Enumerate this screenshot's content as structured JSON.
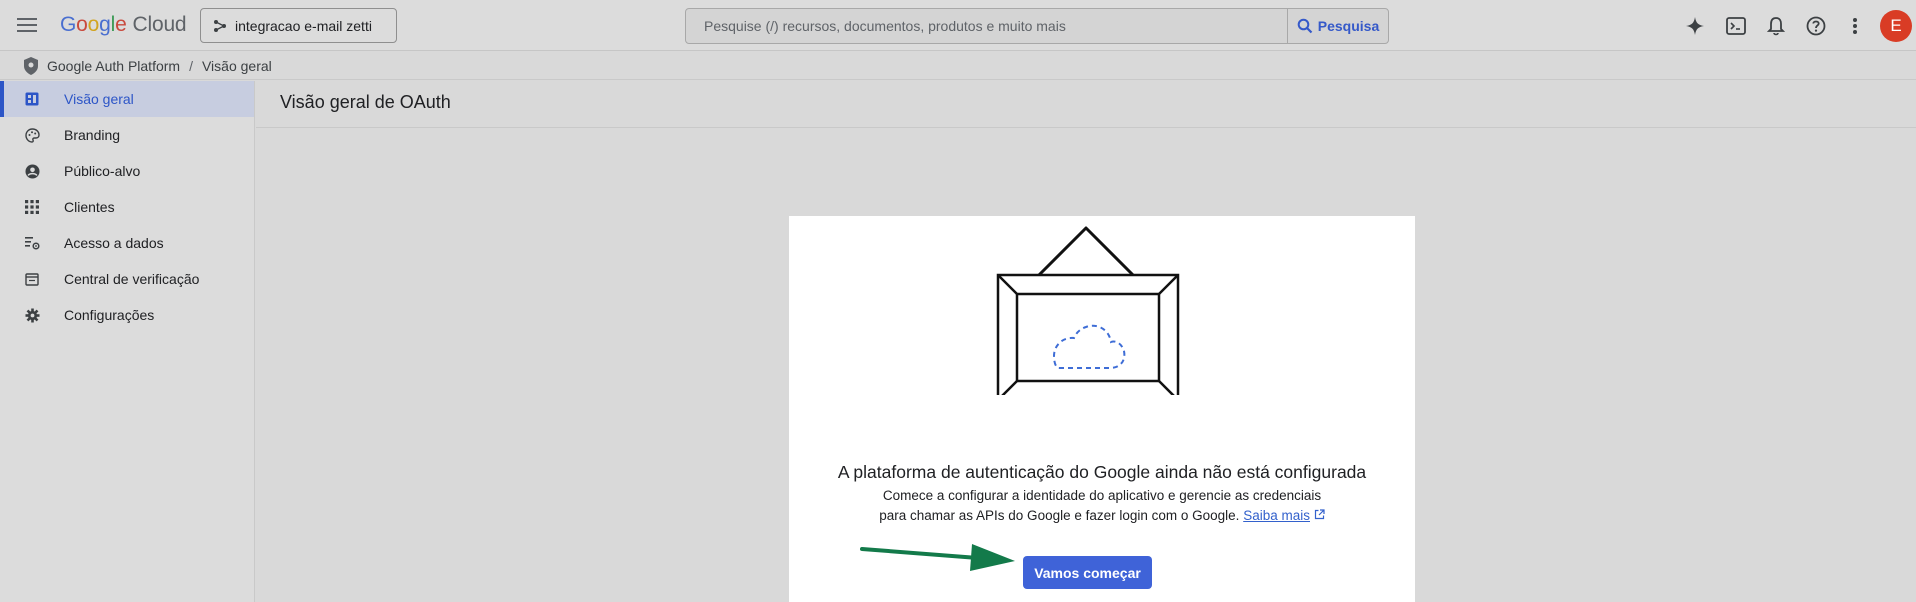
{
  "topbar": {
    "menu_icon": "hamburger-menu-icon",
    "logo_parts": [
      "G",
      "o",
      "o",
      "g",
      "l",
      "e"
    ],
    "logo_product": "Cloud",
    "project_name": "integracao e-mail zetti",
    "search_placeholder": "Pesquise (/) recursos, documentos, produtos e muito mais",
    "search_button_label": "Pesquisa",
    "icons": [
      "gemini-spark-icon",
      "cloud-shell-icon",
      "notifications-bell-icon",
      "help-icon",
      "more-vert-icon"
    ],
    "avatar_initial": "E",
    "avatar_color": "#d93c25"
  },
  "breadcrumb": {
    "product": "Google Auth Platform",
    "separator": "/",
    "current": "Visão geral"
  },
  "sidebar": {
    "items": [
      {
        "label": "Visão geral",
        "icon": "dashboard-icon",
        "active": true
      },
      {
        "label": "Branding",
        "icon": "palette-icon",
        "active": false
      },
      {
        "label": "Público-alvo",
        "icon": "account-circle-icon",
        "active": false
      },
      {
        "label": "Clientes",
        "icon": "apps-grid-icon",
        "active": false
      },
      {
        "label": "Acesso a dados",
        "icon": "data-access-icon",
        "active": false
      },
      {
        "label": "Central de verificação",
        "icon": "verification-icon",
        "active": false
      },
      {
        "label": "Configurações",
        "icon": "settings-gear-icon",
        "active": false
      }
    ],
    "accent_color": "#2c55c7"
  },
  "main": {
    "title": "Visão geral de OAuth",
    "card": {
      "illustration": "framed-cloud-illustration",
      "heading": "A plataforma de autenticação do Google ainda não está configurada",
      "description_line1": "Comece a configurar a identidade do aplicativo e gerencie as credenciais",
      "description_line2": "para chamar as APIs do Google e fazer login com o Google.",
      "learn_more_label": "Saiba mais",
      "learn_more_icon": "open-in-new-icon",
      "cta_label": "Vamos começar",
      "cta_color": "#3f63d8"
    },
    "annotation_arrow_color": "#137a4a"
  }
}
